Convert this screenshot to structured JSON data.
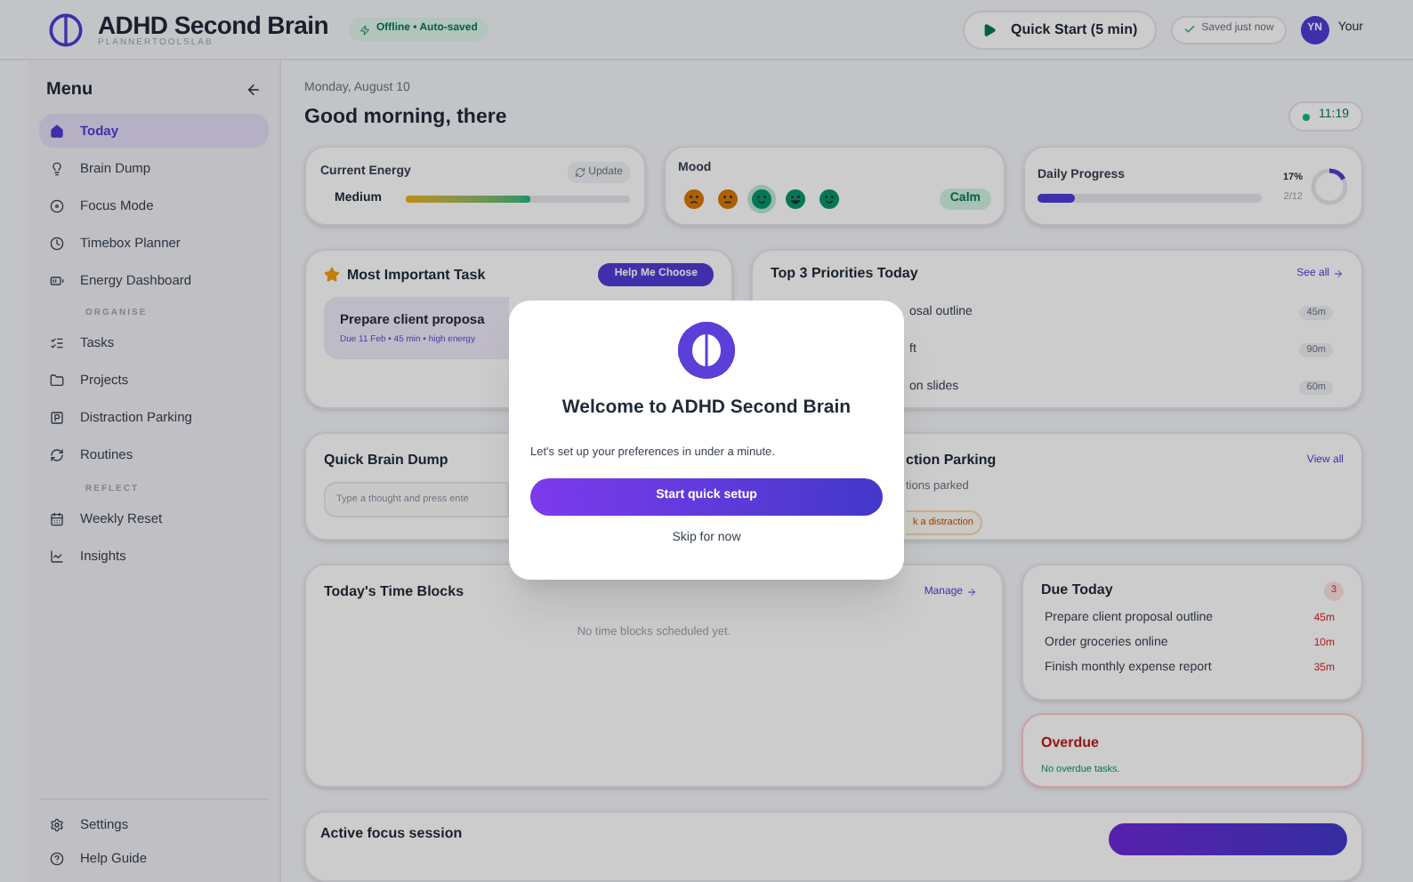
{
  "header": {
    "title": "ADHD Second Brain",
    "subtitle": "PLANNERTOOLSLAB",
    "status_badge": "Offline • Auto-saved",
    "quick_start": "Quick Start (5 min)",
    "save_status": "Saved just now",
    "avatar": "YN",
    "user": "Your"
  },
  "sidebar": {
    "title": "Menu",
    "groups": [
      {
        "items": [
          {
            "label": "Today",
            "selected": true
          },
          {
            "label": "Brain Dump",
            "selected": false
          },
          {
            "label": "Focus Mode",
            "selected": false
          },
          {
            "label": "Timebox Planner",
            "selected": false
          },
          {
            "label": "Energy Dashboard",
            "selected": false
          }
        ]
      },
      {
        "label": "ORGANISE",
        "items": [
          {
            "label": "Tasks",
            "selected": false
          },
          {
            "label": "Projects",
            "selected": false
          },
          {
            "label": "Distraction Parking",
            "selected": false
          },
          {
            "label": "Routines",
            "selected": false
          }
        ]
      },
      {
        "label": "REFLECT",
        "items": [
          {
            "label": "Weekly Reset",
            "selected": false
          },
          {
            "label": "Insights",
            "selected": false
          }
        ]
      }
    ],
    "footer": [
      {
        "label": "Settings"
      },
      {
        "label": "Help Guide"
      }
    ]
  },
  "main": {
    "date": "Monday, August 10",
    "greeting": "Good morning, there",
    "clock": "11:19"
  },
  "energy": {
    "title": "Current Energy",
    "update": "Update",
    "value": "Medium",
    "level": 0.55
  },
  "mood": {
    "title": "Mood",
    "faces": [
      {
        "kind": "sad",
        "selected": false
      },
      {
        "kind": "neutral",
        "selected": false
      },
      {
        "kind": "smile",
        "selected": true
      },
      {
        "kind": "grin",
        "selected": false
      },
      {
        "kind": "happy",
        "selected": false
      }
    ],
    "label": "Calm"
  },
  "progress": {
    "title": "Daily Progress",
    "percent": "17%",
    "count": "2/12",
    "level": 0.17
  },
  "mit": {
    "title": "Most Important Task",
    "help": "Help Me Choose",
    "task": "Prepare client proposa",
    "meta": "Due 11 Feb • 45 min • high energy"
  },
  "priorities": {
    "title": "Top 3 Priorities Today",
    "see_all": "See all",
    "items": [
      {
        "text": "osal outline",
        "duration": "45m"
      },
      {
        "text": "ft",
        "duration": "90m"
      },
      {
        "text": "on slides",
        "duration": "60m"
      }
    ]
  },
  "brain_dump": {
    "title": "Quick Brain Dump",
    "placeholder": "Type a thought and press ente"
  },
  "distraction": {
    "title": "ction Parking",
    "view_all": "View all",
    "count_text": "tions parked",
    "button": "k a distraction"
  },
  "time_blocks": {
    "title": "Today's Time Blocks",
    "manage": "Manage",
    "empty": "No time blocks scheduled yet."
  },
  "due_today": {
    "title": "Due Today",
    "count": "3",
    "items": [
      {
        "text": "Prepare client proposal outline",
        "duration": "45m"
      },
      {
        "text": "Order groceries online",
        "duration": "10m"
      },
      {
        "text": "Finish monthly expense report",
        "duration": "35m"
      }
    ]
  },
  "overdue": {
    "title": "Overdue",
    "empty": "No overdue tasks."
  },
  "focus": {
    "title": "Active focus session"
  },
  "modal": {
    "title": "Welcome to ADHD Second Brain",
    "text": "Let's set up your preferences in under a minute.",
    "primary": "Start quick setup",
    "secondary": "Skip for now"
  }
}
